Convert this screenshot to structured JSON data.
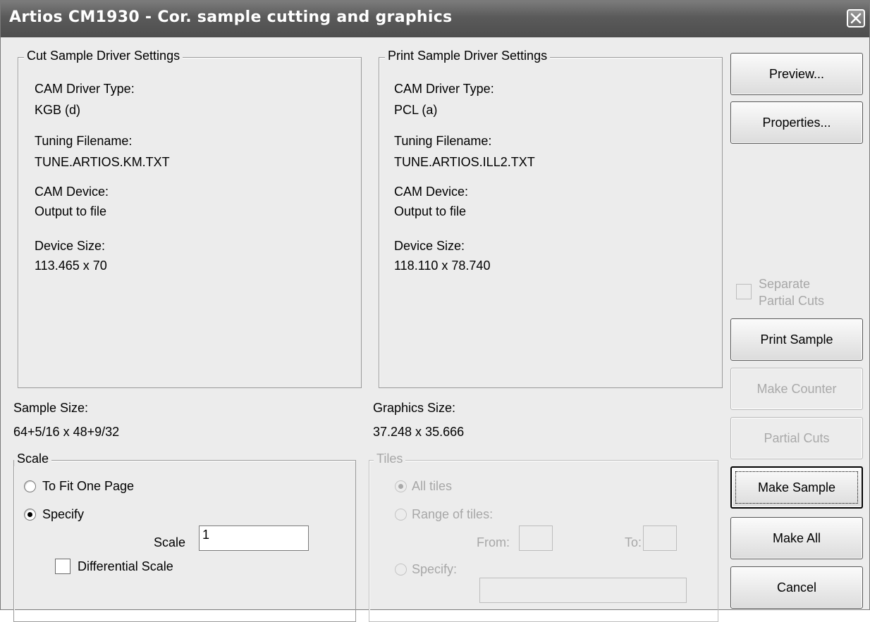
{
  "window": {
    "title": "Artios CM1930 - Cor. sample cutting and graphics"
  },
  "cut_group": {
    "legend": "Cut Sample Driver Settings",
    "driver_type_label": "CAM Driver Type:",
    "driver_type_value": "KGB (d)",
    "tuning_label": "Tuning Filename:",
    "tuning_value": "TUNE.ARTIOS.KM.TXT",
    "device_label": "CAM Device:",
    "device_value": "Output to file",
    "size_label": "Device Size:",
    "size_value": "113.465 x 70"
  },
  "print_group": {
    "legend": "Print Sample Driver Settings",
    "driver_type_label": "CAM Driver Type:",
    "driver_type_value": "PCL (a)",
    "tuning_label": "Tuning Filename:",
    "tuning_value": "TUNE.ARTIOS.ILL2.TXT",
    "device_label": "CAM Device:",
    "device_value": "Output to file",
    "size_label": "Device Size:",
    "size_value": "118.110 x 78.740"
  },
  "sample_size": {
    "label": "Sample Size:",
    "value": "64+5/16 x 48+9/32"
  },
  "graphics_size": {
    "label": "Graphics Size:",
    "value": "37.248 x 35.666"
  },
  "scale_group": {
    "legend": "Scale",
    "fit_one_page": "To Fit One Page",
    "specify": "Specify",
    "selected": "Specify",
    "scale_label": "Scale",
    "scale_value": "1",
    "differential_scale": "Differential Scale",
    "differential_checked": false
  },
  "tiles_group": {
    "legend": "Tiles",
    "all_tiles": "All tiles",
    "range": "Range of tiles:",
    "from_label": "From:",
    "from_value": "",
    "to_label": "To:",
    "to_value": "",
    "specify": "Specify:",
    "specify_value": "",
    "selected": "All tiles",
    "enabled": false
  },
  "side": {
    "preview": "Preview...",
    "properties": "Properties...",
    "separate_partial_cuts": "Separate Partial Cuts",
    "separate_partial_cuts_line1": "Separate",
    "separate_partial_cuts_line2": "Partial Cuts",
    "print_sample": "Print Sample",
    "make_counter": "Make Counter",
    "partial_cuts": "Partial Cuts",
    "make_sample": "Make Sample",
    "make_all": "Make All",
    "cancel": "Cancel"
  }
}
